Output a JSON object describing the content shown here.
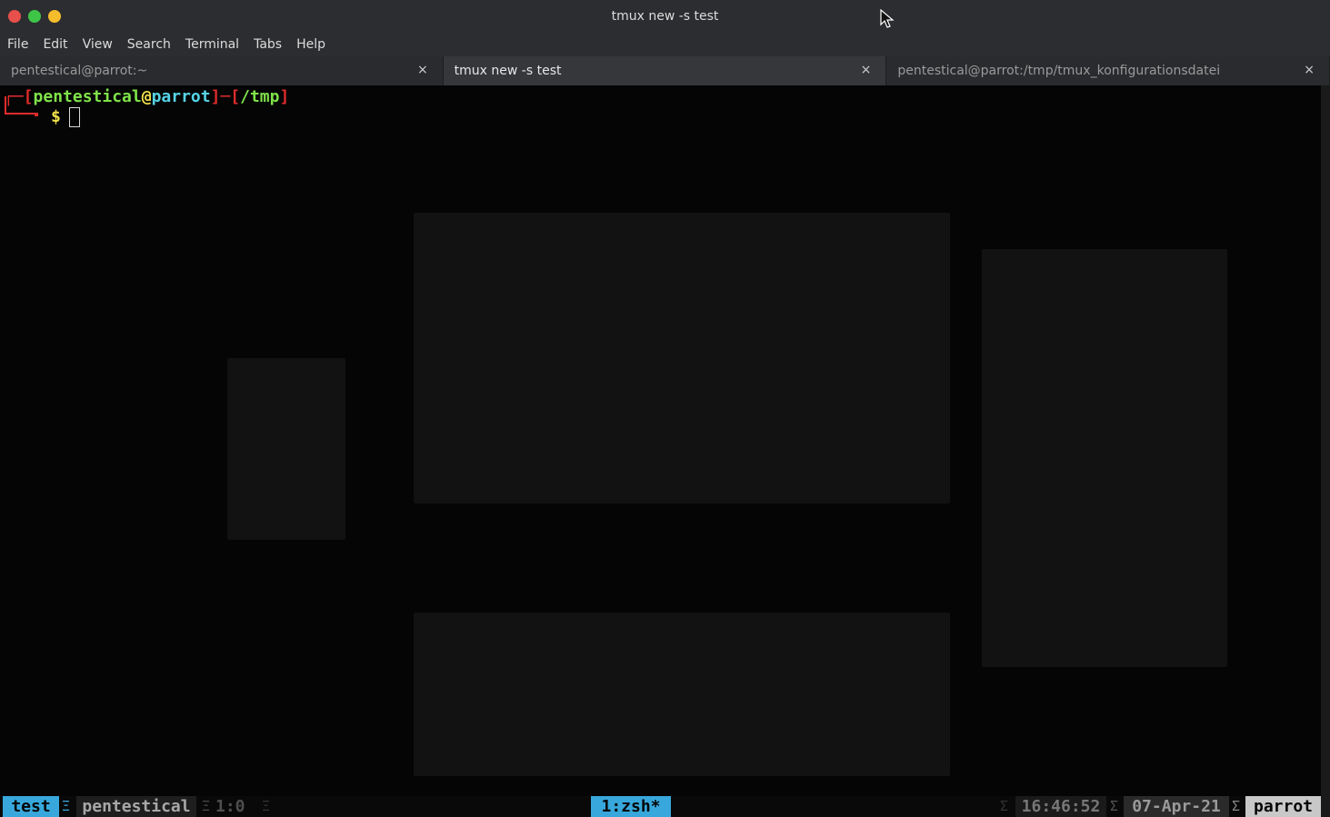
{
  "window": {
    "title": "tmux new -s test"
  },
  "menu": {
    "items": [
      "File",
      "Edit",
      "View",
      "Search",
      "Terminal",
      "Tabs",
      "Help"
    ]
  },
  "tabs": [
    {
      "label": "pentestical@parrot:~",
      "active": false
    },
    {
      "label": "tmux new -s test",
      "active": true
    },
    {
      "label": "pentestical@parrot:/tmp/tmux_konfigurationsdatei",
      "active": false
    }
  ],
  "tab_close_glyph": "×",
  "prompt": {
    "open_bracket": "┌─[",
    "user": "pentestical",
    "at": "@",
    "host": "parrot",
    "mid": "]─[",
    "path": "/tmp",
    "close_bracket": "]",
    "symbol": "$"
  },
  "status": {
    "session": "test",
    "user": "pentestical",
    "pane": "1:0",
    "window": "1:zsh*",
    "time": "16:46:52",
    "date": "07-Apr-21",
    "host": "parrot",
    "sep_left": "Ξ",
    "sep_right": "Σ"
  },
  "colors": {
    "prompt_bracket": "#e02b2b",
    "prompt_user": "#7fe24a",
    "prompt_at": "#f1e14a",
    "prompt_host": "#56d3e6",
    "status_accent": "#38a8dc"
  },
  "icons": {
    "close": "close-icon",
    "pointer": "mouse-pointer-icon"
  }
}
